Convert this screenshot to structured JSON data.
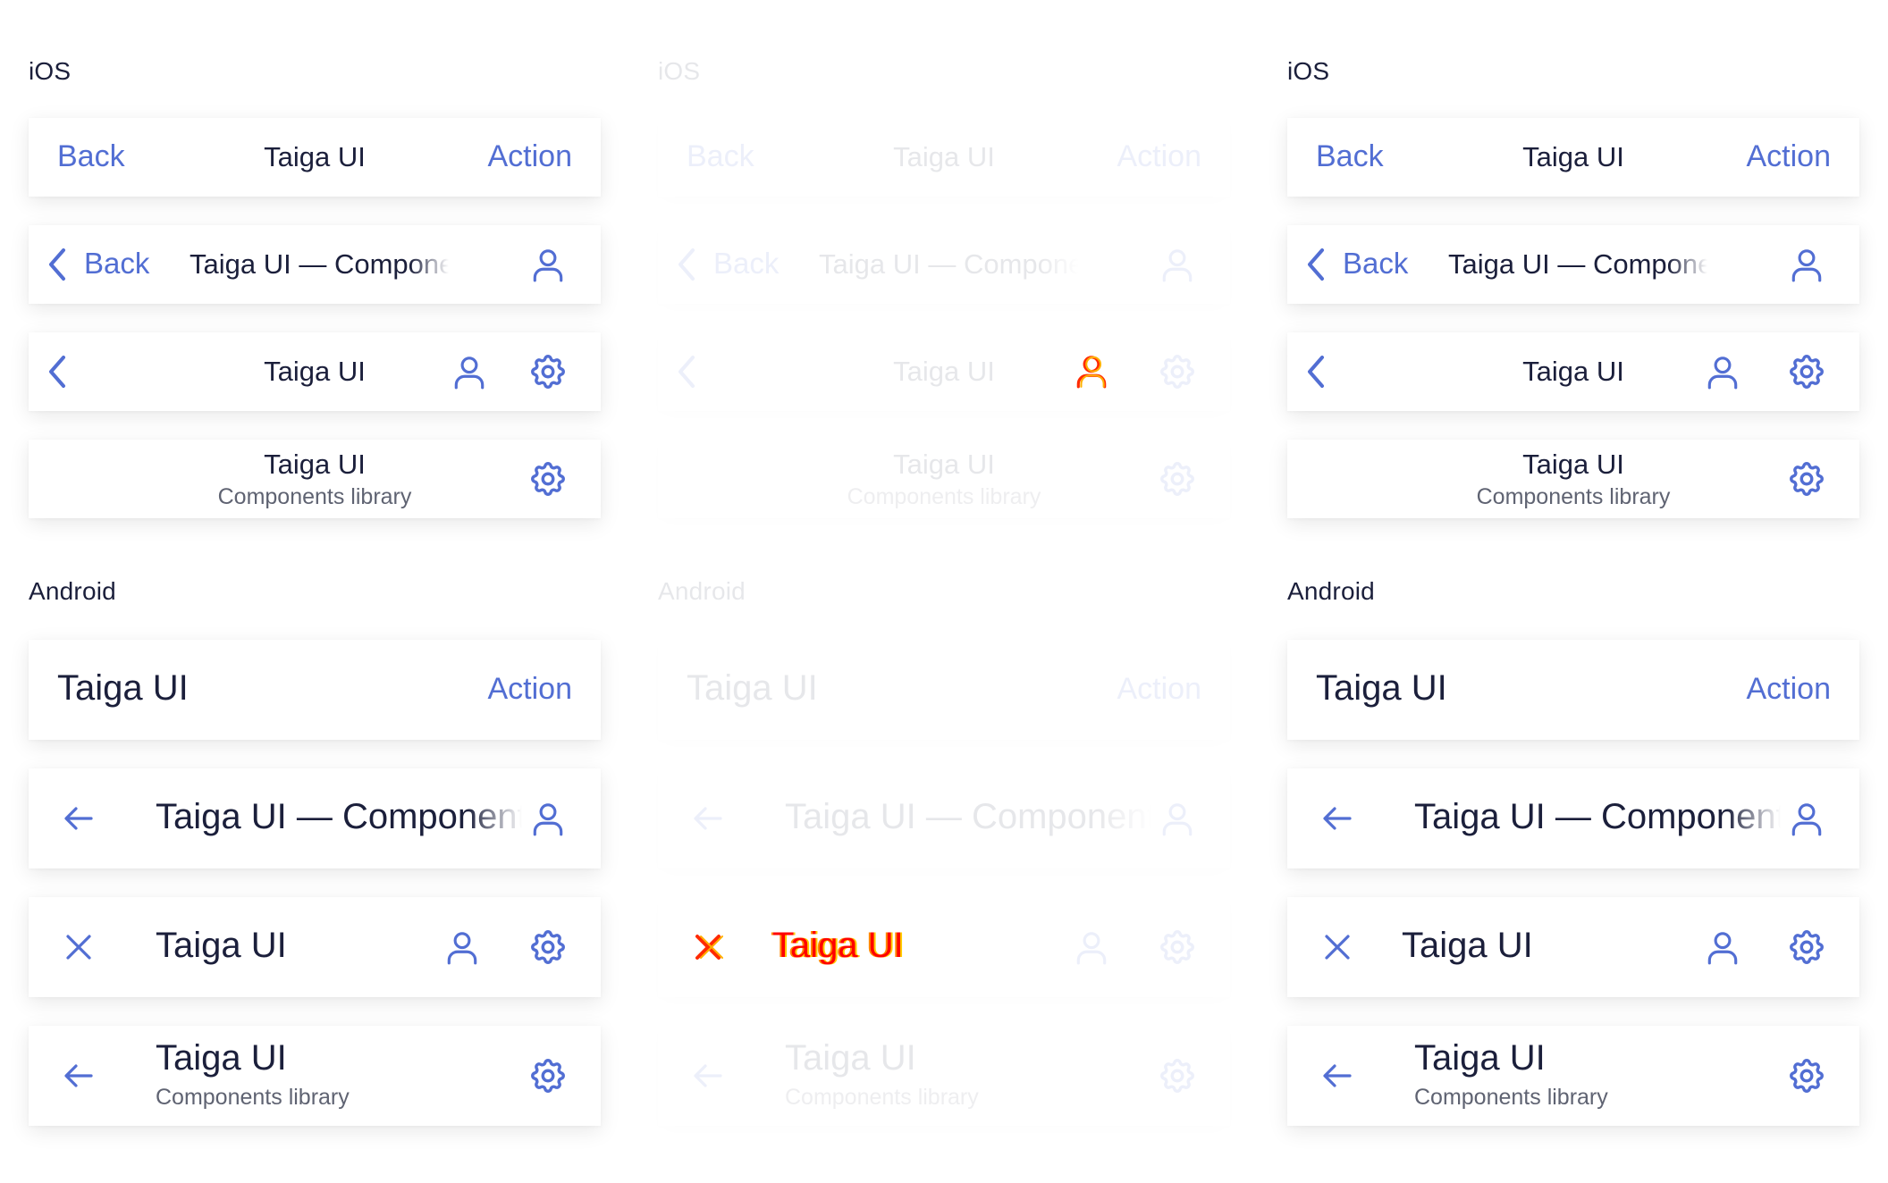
{
  "colors": {
    "accent": "#526ed3",
    "text": "#1b1f3b",
    "muted": "#5f6372",
    "glitch": "#ff0000"
  },
  "sections": {
    "ios": "iOS",
    "android": "Android"
  },
  "ios": {
    "bar1": {
      "back": "Back",
      "title": "Taiga UI",
      "action": "Action"
    },
    "bar2": {
      "back": "Back",
      "title": "Taiga UI — Components"
    },
    "bar3": {
      "title": "Taiga UI"
    },
    "bar4": {
      "title": "Taiga UI",
      "subtitle": "Components library"
    }
  },
  "android": {
    "bar1": {
      "title": "Taiga UI",
      "action": "Action"
    },
    "bar2": {
      "title": "Taiga UI — Components"
    },
    "bar3": {
      "title": "Taiga UI"
    },
    "bar4": {
      "title": "Taiga UI",
      "subtitle": "Components library"
    }
  },
  "icons": [
    "chevron-left-icon",
    "user-icon",
    "gear-icon",
    "arrow-left-icon",
    "close-icon"
  ]
}
